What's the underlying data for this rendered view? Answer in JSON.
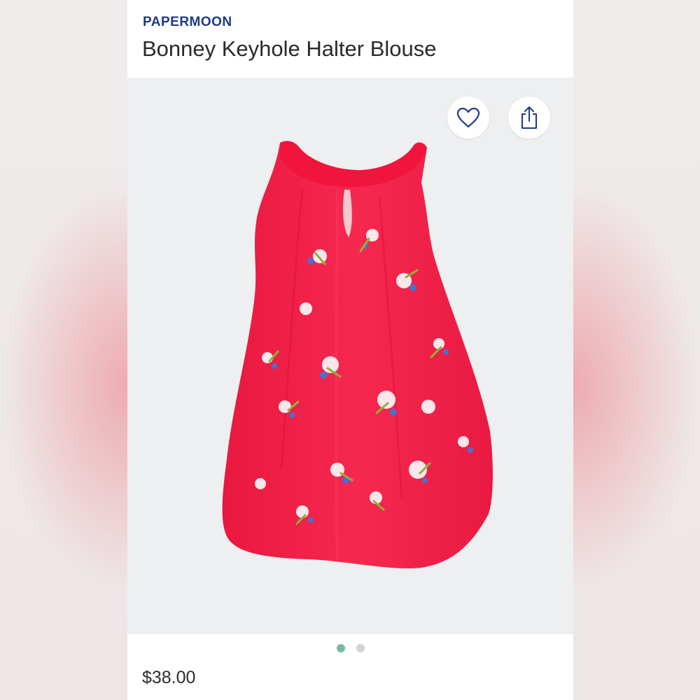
{
  "product": {
    "brand": "PAPERMOON",
    "title": "Bonney Keyhole Halter Blouse",
    "price": "$38.00"
  },
  "actions": {
    "favorite_icon": "heart-outline-icon",
    "share_icon": "share-upload-icon"
  },
  "carousel": {
    "total": 2,
    "active_index": 0
  },
  "colors": {
    "brand": "#1d3a86",
    "garment": "#f5234a",
    "active_dot": "#7cb8a8",
    "inactive_dot": "#d3d3d3"
  }
}
